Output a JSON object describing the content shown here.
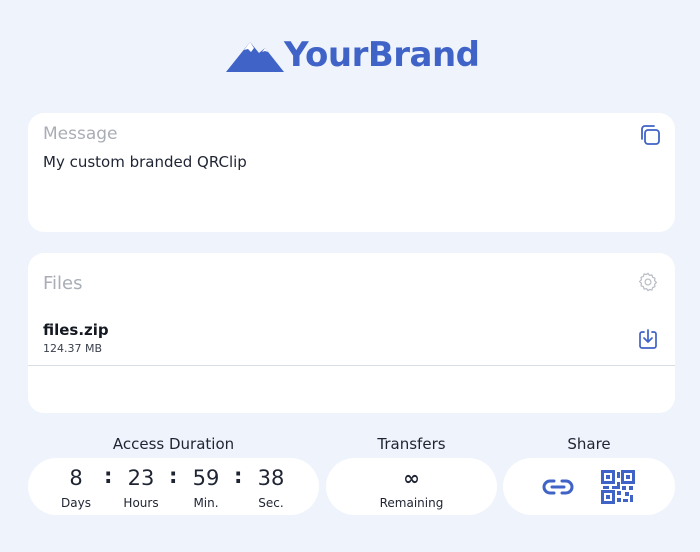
{
  "brand": {
    "name": "YourBrand",
    "icon": "mountain-logo",
    "color": "#3f63c7"
  },
  "message": {
    "label": "Message",
    "text": "My custom branded QRClip",
    "copy_icon": "copy-icon"
  },
  "files": {
    "label": "Files",
    "settings_icon": "gear-icon",
    "items": [
      {
        "name": "files.zip",
        "size": "124.37 MB",
        "action_icon": "download-icon"
      }
    ]
  },
  "access_duration": {
    "title": "Access Duration",
    "days": {
      "value": "8",
      "label": "Days"
    },
    "hours": {
      "value": "23",
      "label": "Hours"
    },
    "minutes": {
      "value": "59",
      "label": "Min."
    },
    "seconds": {
      "value": "38",
      "label": "Sec."
    },
    "separator": ":"
  },
  "transfers": {
    "title": "Transfers",
    "value": "∞",
    "label": "Remaining"
  },
  "share": {
    "title": "Share",
    "icons": [
      "link-icon",
      "qr-code-icon"
    ]
  },
  "colors": {
    "background": "#eef3fc",
    "accent": "#3f63c7",
    "card": "#ffffff"
  }
}
